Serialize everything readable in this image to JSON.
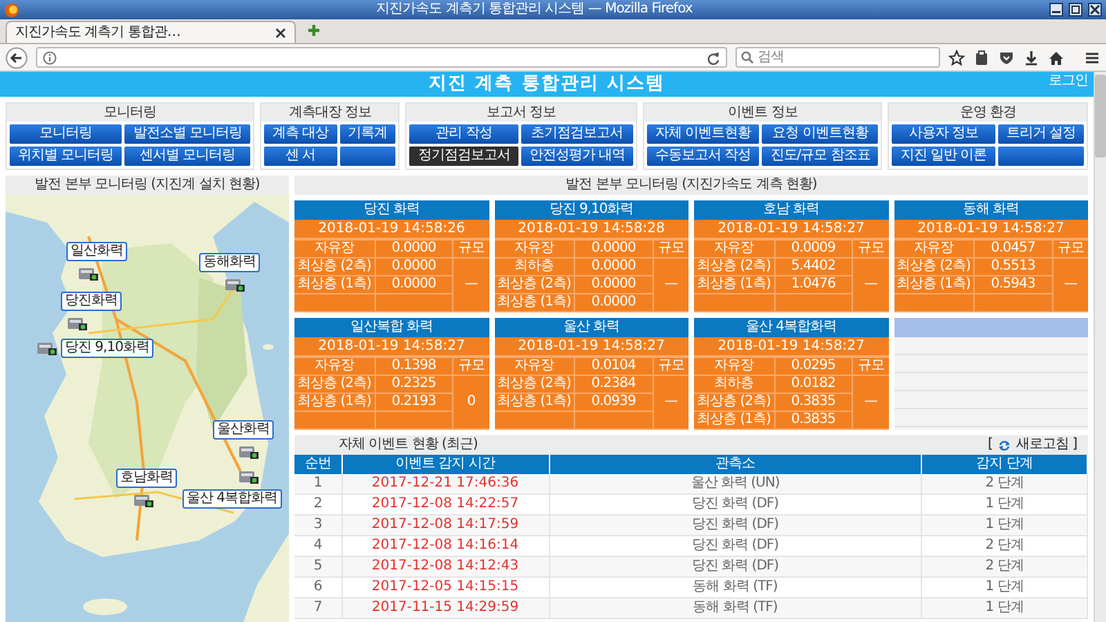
{
  "window": {
    "title": "지진가속도 계측기 통합관리 시스템 — Mozilla Firefox"
  },
  "browser": {
    "tab": {
      "title": "지진가속도 계측기 통합관…",
      "selected": true
    },
    "search": {
      "placeholder": "검색"
    }
  },
  "header": {
    "title": "지진 계측 통합관리 시스템",
    "login": "로그인"
  },
  "menu": [
    {
      "title": "모니터링",
      "buttons": [
        {
          "label": "모니터링",
          "selected": false
        },
        {
          "label": "발전소별 모니터링",
          "selected": false
        },
        {
          "label": "위치별 모니터링",
          "selected": false
        },
        {
          "label": "센서별 모니터링",
          "selected": false
        }
      ]
    },
    {
      "title": "계측대장 정보",
      "buttons": [
        {
          "label": "계측 대상",
          "selected": false
        },
        {
          "label": "기록계",
          "selected": false
        },
        {
          "label": "센 서",
          "selected": false
        },
        {
          "selected": false
        }
      ]
    },
    {
      "title": "보고서 정보",
      "buttons": [
        {
          "label": "관리 작성",
          "selected": false
        },
        {
          "label": "초기점검보고서",
          "selected": false
        },
        {
          "label": "정기점검보고서",
          "selected": true
        },
        {
          "label": "안전성평가 내역",
          "selected": false
        }
      ]
    },
    {
      "title": "이벤트 정보",
      "buttons": [
        {
          "label": "자체 이벤트현황",
          "selected": false
        },
        {
          "label": "요청 이벤트현황",
          "selected": false
        },
        {
          "label": "수동보고서 작성",
          "selected": false
        },
        {
          "label": "진도/규모 참조표",
          "selected": false
        }
      ]
    },
    {
      "title": "운영 환경",
      "buttons": [
        {
          "label": "사용자 정보",
          "selected": false
        },
        {
          "label": "트리거 설정",
          "selected": false
        },
        {
          "label": "지진 일반 이론",
          "selected": false
        },
        {
          "selected": false
        }
      ]
    }
  ],
  "map_panel": {
    "title": "발전 본부 모니터링 (지진계 설치 현황)",
    "markers": [
      {
        "label": "일산화력"
      },
      {
        "label": "당진화력"
      },
      {
        "label": "당진 9,10화력"
      },
      {
        "label": "동해화력"
      },
      {
        "label": "울산화력"
      },
      {
        "label": "울산 4복합화력"
      },
      {
        "label": "호남화력"
      }
    ]
  },
  "station_panel": {
    "title": "발전 본부 모니터링 (지진가속도 계측 현황)",
    "stations": [
      {
        "kind": "station",
        "name": "당진 화력",
        "time": "2018-01-19 14:58:26",
        "scale_label": "규모",
        "magnitude": "—",
        "rows": [
          {
            "label": "자유장",
            "value": "0.0000"
          },
          {
            "label": "최상층 (2측)",
            "value": "0.0000"
          },
          {
            "label": "최상층 (1측)",
            "value": "0.0000"
          }
        ]
      },
      {
        "kind": "station",
        "name": "당진 9,10화력",
        "time": "2018-01-19 14:58:28",
        "scale_label": "규모",
        "magnitude": "—",
        "rows": [
          {
            "label": "자유장",
            "value": "0.0000"
          },
          {
            "label": "최하층",
            "value": "0.0000"
          },
          {
            "label": "최상층 (2측)",
            "value": "0.0000"
          },
          {
            "label": "최상층 (1측)",
            "value": "0.0000"
          }
        ]
      },
      {
        "kind": "station",
        "name": "호남 화력",
        "time": "2018-01-19 14:58:27",
        "scale_label": "규모",
        "magnitude": "—",
        "rows": [
          {
            "label": "자유장",
            "value": "0.0009"
          },
          {
            "label": "최상층 (2측)",
            "value": "5.4402"
          },
          {
            "label": "최상층 (1측)",
            "value": "1.0476"
          }
        ]
      },
      {
        "kind": "station",
        "name": "동해 화력",
        "time": "2018-01-19 14:58:27",
        "scale_label": "규모",
        "magnitude": "—",
        "rows": [
          {
            "label": "자유장",
            "value": "0.0457"
          },
          {
            "label": "최상층 (2측)",
            "value": "0.5513"
          },
          {
            "label": "최상층 (1측)",
            "value": "0.5943"
          }
        ]
      },
      {
        "kind": "station",
        "name": "일산복합 화력",
        "time": "2018-01-19 14:58:27",
        "scale_label": "규모",
        "magnitude": "0",
        "rows": [
          {
            "label": "자유장",
            "value": "0.1398"
          },
          {
            "label": "최상층 (2측)",
            "value": "0.2325"
          },
          {
            "label": "최상층 (1측)",
            "value": "0.2193"
          }
        ]
      },
      {
        "kind": "station",
        "name": "울산 화력",
        "time": "2018-01-19 14:58:27",
        "scale_label": "규모",
        "magnitude": "—",
        "rows": [
          {
            "label": "자유장",
            "value": "0.0104"
          },
          {
            "label": "최상층 (2측)",
            "value": "0.2384"
          },
          {
            "label": "최상층 (1측)",
            "value": "0.0939"
          }
        ]
      },
      {
        "kind": "station",
        "name": "울산 4복합화력",
        "time": "2018-01-19 14:58:27",
        "scale_label": "규모",
        "magnitude": "—",
        "rows": [
          {
            "label": "자유장",
            "value": "0.0295"
          },
          {
            "label": "최하층",
            "value": "0.0182"
          },
          {
            "label": "최상층 (2측)",
            "value": "0.3835"
          },
          {
            "label": "최상층 (1측)",
            "value": "0.3835"
          }
        ]
      },
      {
        "kind": "empty"
      }
    ]
  },
  "events": {
    "title": "자체 이벤트 현황 (최근)",
    "refresh": {
      "open": "[",
      "label": "새로고침",
      "close": "]"
    },
    "columns": [
      "순번",
      "이벤트 감지 시간",
      "관측소",
      "감지 단계"
    ],
    "rows": [
      [
        "1",
        "2017-12-21 17:46:36",
        "울산 화력 (UN)",
        "2 단계"
      ],
      [
        "2",
        "2017-12-08 14:22:57",
        "당진 화력 (DF)",
        "1 단계"
      ],
      [
        "3",
        "2017-12-08 14:17:59",
        "당진 화력 (DF)",
        "1 단계"
      ],
      [
        "4",
        "2017-12-08 14:16:14",
        "당진 화력 (DF)",
        "2 단계"
      ],
      [
        "5",
        "2017-12-08 14:12:43",
        "당진 화력 (DF)",
        "2 단계"
      ],
      [
        "6",
        "2017-12-05 14:15:15",
        "동해 화력 (TF)",
        "1 단계"
      ],
      [
        "7",
        "2017-11-15 14:29:59",
        "동해 화력 (TF)",
        "1 단계"
      ]
    ]
  }
}
